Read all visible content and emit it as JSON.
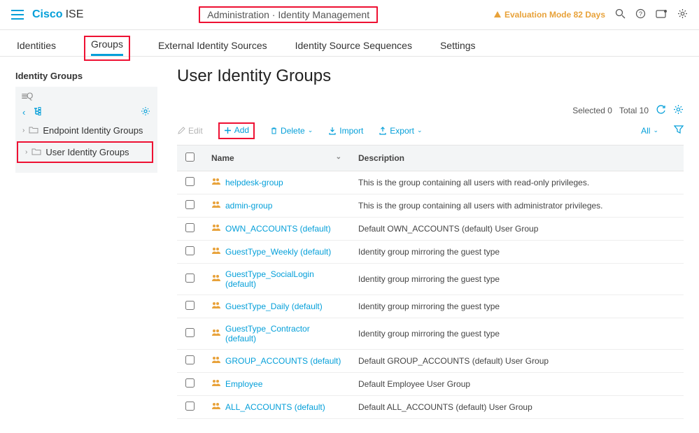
{
  "header": {
    "brand": "Cisco",
    "product": "ISE",
    "breadcrumb": "Administration · Identity Management",
    "eval_label": "Evaluation Mode 82 Days"
  },
  "tabs": {
    "items": [
      {
        "label": "Identities",
        "active": false
      },
      {
        "label": "Groups",
        "active": true
      },
      {
        "label": "External Identity Sources",
        "active": false
      },
      {
        "label": "Identity Source Sequences",
        "active": false
      },
      {
        "label": "Settings",
        "active": false
      }
    ]
  },
  "sidebar": {
    "title": "Identity Groups",
    "search_placeholder": "",
    "items": [
      {
        "label": "Endpoint Identity Groups"
      },
      {
        "label": "User Identity Groups"
      }
    ]
  },
  "page": {
    "title": "User Identity Groups",
    "selected_label": "Selected 0",
    "total_label": "Total 10"
  },
  "toolbar": {
    "edit": "Edit",
    "add": "Add",
    "delete": "Delete",
    "import": "Import",
    "export": "Export",
    "all": "All"
  },
  "table": {
    "columns": {
      "name": "Name",
      "description": "Description"
    },
    "rows": [
      {
        "name": "helpdesk-group",
        "description": "This is the group containing all users with read-only privileges."
      },
      {
        "name": "admin-group",
        "description": "This is the group containing all users with administrator privileges."
      },
      {
        "name": "OWN_ACCOUNTS (default)",
        "description": "Default OWN_ACCOUNTS (default) User Group"
      },
      {
        "name": "GuestType_Weekly (default)",
        "description": "Identity group mirroring the guest type"
      },
      {
        "name": "GuestType_SocialLogin (default)",
        "description": "Identity group mirroring the guest type"
      },
      {
        "name": "GuestType_Daily (default)",
        "description": "Identity group mirroring the guest type"
      },
      {
        "name": "GuestType_Contractor (default)",
        "description": "Identity group mirroring the guest type"
      },
      {
        "name": "GROUP_ACCOUNTS (default)",
        "description": "Default GROUP_ACCOUNTS (default) User Group"
      },
      {
        "name": "Employee",
        "description": "Default Employee User Group"
      },
      {
        "name": "ALL_ACCOUNTS (default)",
        "description": "Default ALL_ACCOUNTS (default) User Group"
      }
    ]
  }
}
